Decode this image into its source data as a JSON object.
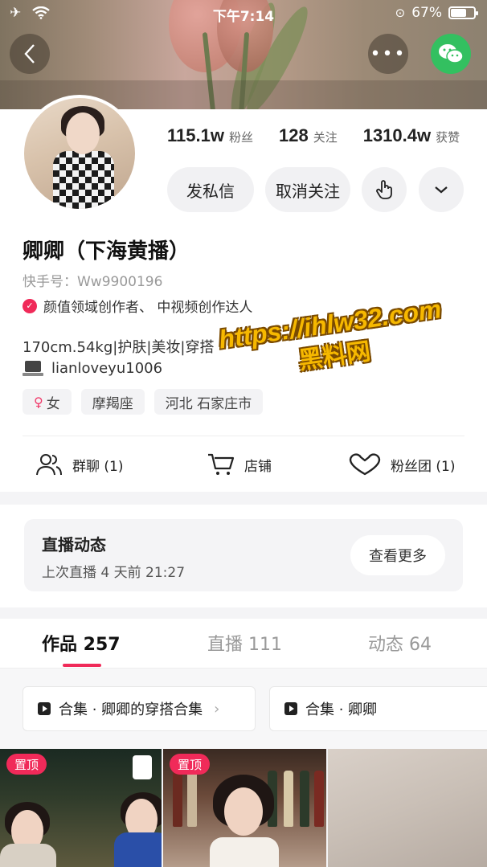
{
  "status_bar": {
    "time": "下午7:14",
    "battery": "67%"
  },
  "profile": {
    "stats": [
      {
        "value": "115.1w",
        "label": "粉丝"
      },
      {
        "value": "128",
        "label": "关注"
      },
      {
        "value": "1310.4w",
        "label": "获赞"
      }
    ],
    "buttons": {
      "message": "发私信",
      "unfollow": "取消关注"
    },
    "name": "卿卿（下海黄播）",
    "kuaishou_id": "快手号：Ww9900196",
    "certification": "颜值领域创作者、 中视频创作达人",
    "bio_line1": "170cm.54kg|护肤|美妆|穿搭",
    "bio_line2": "lianloveyu1006",
    "tags": [
      {
        "symbol": "♀",
        "text": "女"
      },
      {
        "text": "摩羯座"
      },
      {
        "text": "河北 石家庄市"
      }
    ],
    "links": {
      "group": "群聊 (1)",
      "shop": "店铺",
      "fans": "粉丝团 (1)"
    }
  },
  "watermark": {
    "url": "https://ihlw32.com",
    "text": "黑料网"
  },
  "live": {
    "title": "直播动态",
    "subtitle": "上次直播 4 天前 21:27",
    "more": "查看更多"
  },
  "tabs": [
    {
      "label": "作品 257",
      "active": true
    },
    {
      "label": "直播 111",
      "active": false
    },
    {
      "label": "动态 64",
      "active": false
    }
  ],
  "collections": [
    {
      "label": "合集 · 卿卿的穿搭合集"
    },
    {
      "label": "合集 · 卿卿"
    }
  ],
  "thumbnails": [
    {
      "badge": "置顶"
    },
    {
      "badge": "置顶"
    }
  ],
  "colors": {
    "accent": "#f02a59",
    "wechat": "#33c060",
    "watermark": "#f6b800"
  }
}
